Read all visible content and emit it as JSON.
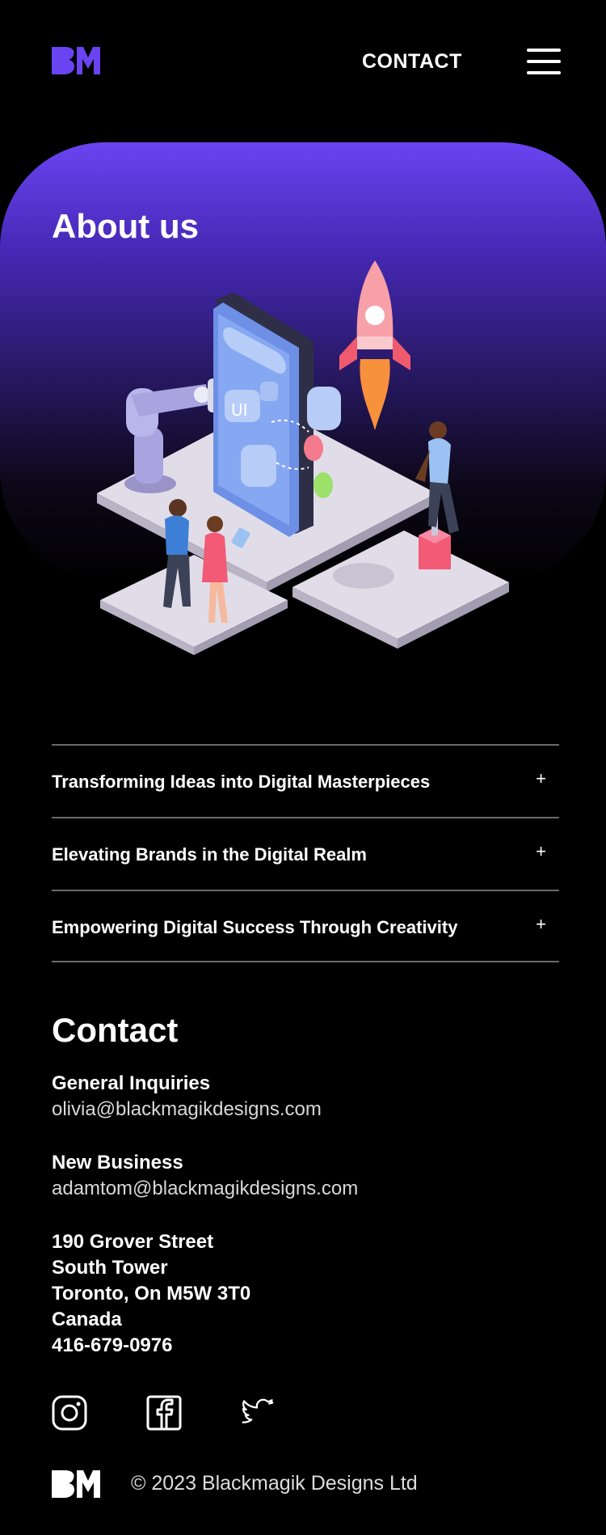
{
  "header": {
    "logo_alt": "BM",
    "contact_label": "CONTACT",
    "menu_icon": "hamburger-menu-icon"
  },
  "hero": {
    "title": "About us",
    "badge_text": "UI",
    "colors": {
      "top": "#6a44f1",
      "bottom": "#000000"
    }
  },
  "accordion": {
    "items": [
      {
        "label": "Transforming Ideas into Digital Masterpieces",
        "toggle": "+"
      },
      {
        "label": "Elevating Brands in the Digital Realm",
        "toggle": "+"
      },
      {
        "label": "Empowering Digital Success Through Creativity",
        "toggle": "+"
      }
    ]
  },
  "contact": {
    "title": "Contact",
    "general_label": "General Inquiries",
    "general_email": "olivia@blackmagikdesigns.com",
    "business_label": "New Business",
    "business_email": "adamtom@blackmagikdesigns.com",
    "address": [
      "190 Grover Street",
      "South Tower",
      "Toronto, On M5W 3T0",
      "Canada",
      "416-679-0976"
    ]
  },
  "social": {
    "icons": [
      "instagram-icon",
      "facebook-icon",
      "twitter-icon"
    ]
  },
  "footer": {
    "copyright": "© 2023 Blackmagik Designs Ltd"
  },
  "colors": {
    "brand": "#6a44f1",
    "background": "#000000"
  }
}
